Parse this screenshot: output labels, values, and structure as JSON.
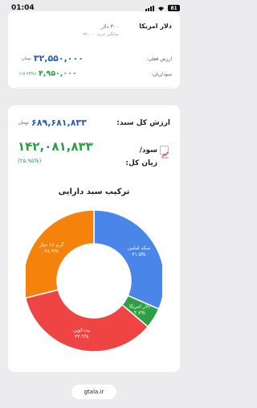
{
  "status_bar": {
    "time": "01:04",
    "battery": "81"
  },
  "asset_card": {
    "name": "دلار امریکا",
    "quantity": "۳۰۰ دلار",
    "avg_buy_price": "میانگین خرید: ۹۲,۰۰۰",
    "current_value_label": "ارزش فعلی:",
    "current_value": "۳۲,۵۵۰,۰۰۰",
    "current_value_unit": "تومان",
    "profit_label": "سود/زیان:",
    "profit_value": "۴,۹۵۰,۰۰۰",
    "profit_percent": "(۱۷.۹۳%)"
  },
  "portfolio": {
    "total_label": "ارزش کل سبد:",
    "total_value": "۶۸۹,۶۸۱,۸۳۳",
    "total_unit": "تومان",
    "profit_label": "سود/زیان کل:",
    "profit_value": "۱۴۲,۰۸۱,۸۳۳",
    "profit_percent": "(۲۵.۹۵%)",
    "composition_title": "ترکیب سبد دارایی"
  },
  "chart_data": {
    "type": "pie",
    "variant": "donut",
    "slices": [
      {
        "label": "سکه امامی",
        "value_text": "۳۱.۵%",
        "value": 31.5,
        "color": "#4a86e8"
      },
      {
        "label": "دلار امریکا",
        "value_text": "۴.۷%",
        "value": 4.7,
        "color": "#2f9e44"
      },
      {
        "label": "بیت‌کوین",
        "value_text": "۳۴.۹%",
        "value": 34.9,
        "color": "#ef4444"
      },
      {
        "label": "گرم ۱۸ عیار",
        "value_text": "۲۸.۹%",
        "value": 28.9,
        "color": "#f5820b"
      }
    ]
  },
  "footer": {
    "link": "gtala.ir"
  }
}
